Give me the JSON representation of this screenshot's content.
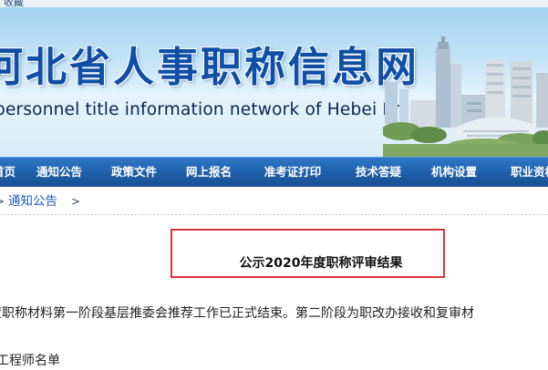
{
  "header": {
    "top_link_fragment": "收藏",
    "site_title_cn": "河北省人事职称信息网",
    "site_title_en": "personnel title information network of Hebei Province"
  },
  "nav": {
    "items": [
      {
        "label": "首页"
      },
      {
        "label": "通知公告"
      },
      {
        "label": "政策文件"
      },
      {
        "label": "网上报名"
      },
      {
        "label": "准考证打印"
      },
      {
        "label": "技术答疑"
      },
      {
        "label": "机构设置"
      },
      {
        "label": "职业资格"
      }
    ]
  },
  "breadcrumb": {
    "link": "通知公告",
    "separator": ">"
  },
  "article": {
    "title": "公示2020年度职称评审结果",
    "paragraph_visible": "度职称材料第一阶段基层推委会推荐工作已正式结束。第二阶段为职改办接收和复审材",
    "cut_line": "工程师名单"
  },
  "colors": {
    "title_blue": "#0f4fa6",
    "nav_blue": "#1f5ea9",
    "highlight_red": "#d9333a",
    "link_blue": "#1a5fb4"
  }
}
